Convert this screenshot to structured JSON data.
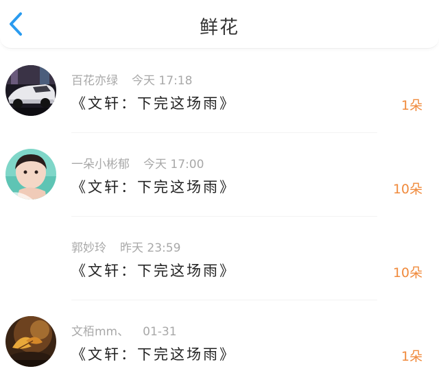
{
  "header": {
    "title": "鲜花",
    "back_icon": "chevron-left-icon",
    "accent_color": "#2a9bef"
  },
  "gifts": [
    {
      "user": "百花亦绿",
      "time": "今天 17:18",
      "message": "《文轩：下完这场雨》",
      "count": "1朵"
    },
    {
      "user": "一朵小彬郁",
      "time": "今天 17:00",
      "message": "《文轩：下完这场雨》",
      "count": "10朵"
    },
    {
      "user": "郭妙玲",
      "time": "昨天 23:59",
      "message": "《文轩：下完这场雨》",
      "count": "10朵"
    },
    {
      "user": "文栢mm、",
      "time": "01-31",
      "message": "《文轩：下完这场雨》",
      "count": "1朵"
    }
  ],
  "colors": {
    "count": "#f08a3c",
    "meta": "#a8a8a8",
    "message": "#222222"
  }
}
